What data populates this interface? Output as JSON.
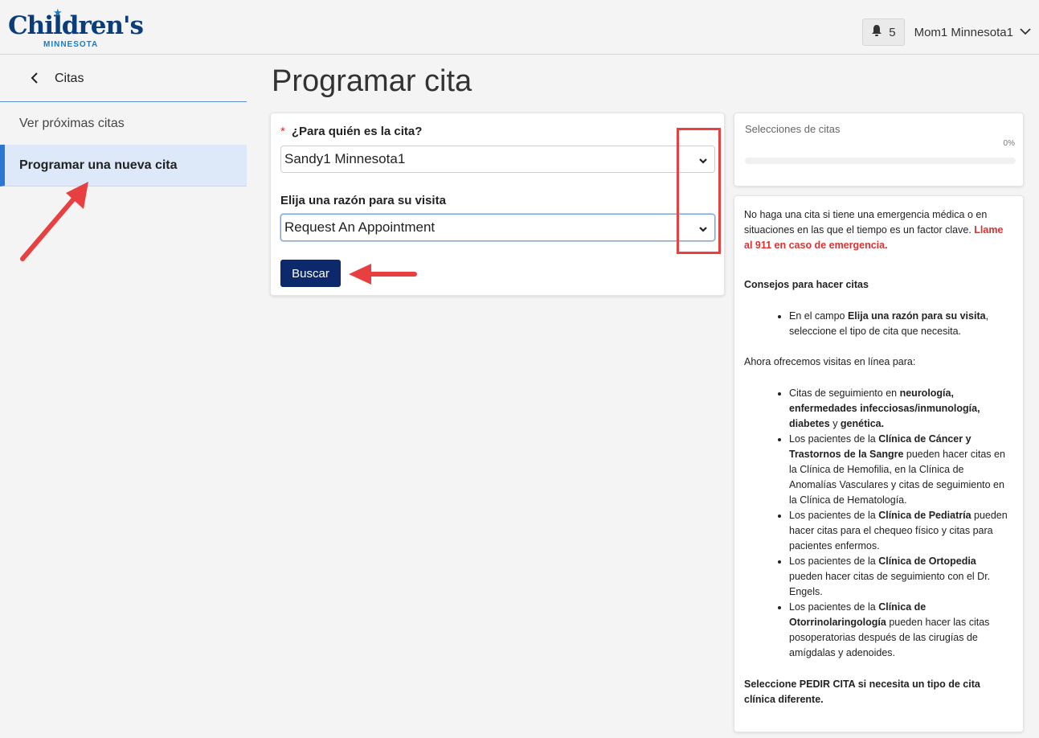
{
  "header": {
    "logo_main": "Children's",
    "logo_sub": "MINNESOTA",
    "notification_count": "5",
    "user_name": "Mom1 Minnesota1"
  },
  "sidebar": {
    "back_label": "Citas",
    "items": [
      {
        "label": "Ver próximas citas",
        "active": false
      },
      {
        "label": "Programar una nueva cita",
        "active": true
      }
    ]
  },
  "main": {
    "title": "Programar cita",
    "form": {
      "patient_label": "¿Para quién es la cita?",
      "patient_value": "Sandy1 Minnesota1",
      "reason_label": "Elija una razón para su visita",
      "reason_value": "Request An Appointment",
      "search_button": "Buscar"
    }
  },
  "progress": {
    "title": "Selecciones de citas",
    "percent_label": "0%",
    "percent_value": 0
  },
  "info": {
    "warning": "No haga una cita si tiene una emergencia médica o en situaciones en las que el tiempo es un factor clave.",
    "emergency": "Llame al 911 en caso de emergencia.",
    "tips_title": "Consejos para hacer citas",
    "tip_pre": "En el campo ",
    "tip_bold": "Elija una razón para su visita",
    "tip_post": ", seleccione el tipo de cita que necesita.",
    "online_intro": "Ahora ofrecemos visitas en línea para:",
    "b1_pre": "Citas de seguimiento en ",
    "b1_bold1": "neurología, enfermedades infecciosas/inmunología, diabetes",
    "b1_mid": " y ",
    "b1_bold2": "genética.",
    "b2_pre": "Los pacientes de la ",
    "b2_bold": "Clínica de Cáncer y Trastornos de la Sangre",
    "b2_post": " pueden hacer citas en la Clínica de Hemofilia, en la Clínica de Anomalías Vasculares y citas de seguimiento en la Clínica de Hematología.",
    "b3_pre": "Los pacientes de la ",
    "b3_bold": "Clínica de Pediatría",
    "b3_post": " pueden hacer citas para el chequeo físico y citas para pacientes enfermos.",
    "b4_pre": "Los pacientes de la ",
    "b4_bold": "Clínica de Ortopedia",
    "b4_post": " pueden hacer citas de seguimiento con el Dr. Engels.",
    "b5_pre": "Los pacientes de la ",
    "b5_bold": "Clínica de Otorrinolaringología",
    "b5_post": " pueden hacer las citas posoperatorias después de las cirugías de amígdalas y adenoides.",
    "footer": "Seleccione PEDIR CITA si necesita un tipo de cita clínica diferente."
  },
  "colors": {
    "brand_navy": "#0c2a6b",
    "accent_blue": "#2b77d1",
    "alert_red": "#e0302e",
    "annotation_red": "#e84040"
  }
}
